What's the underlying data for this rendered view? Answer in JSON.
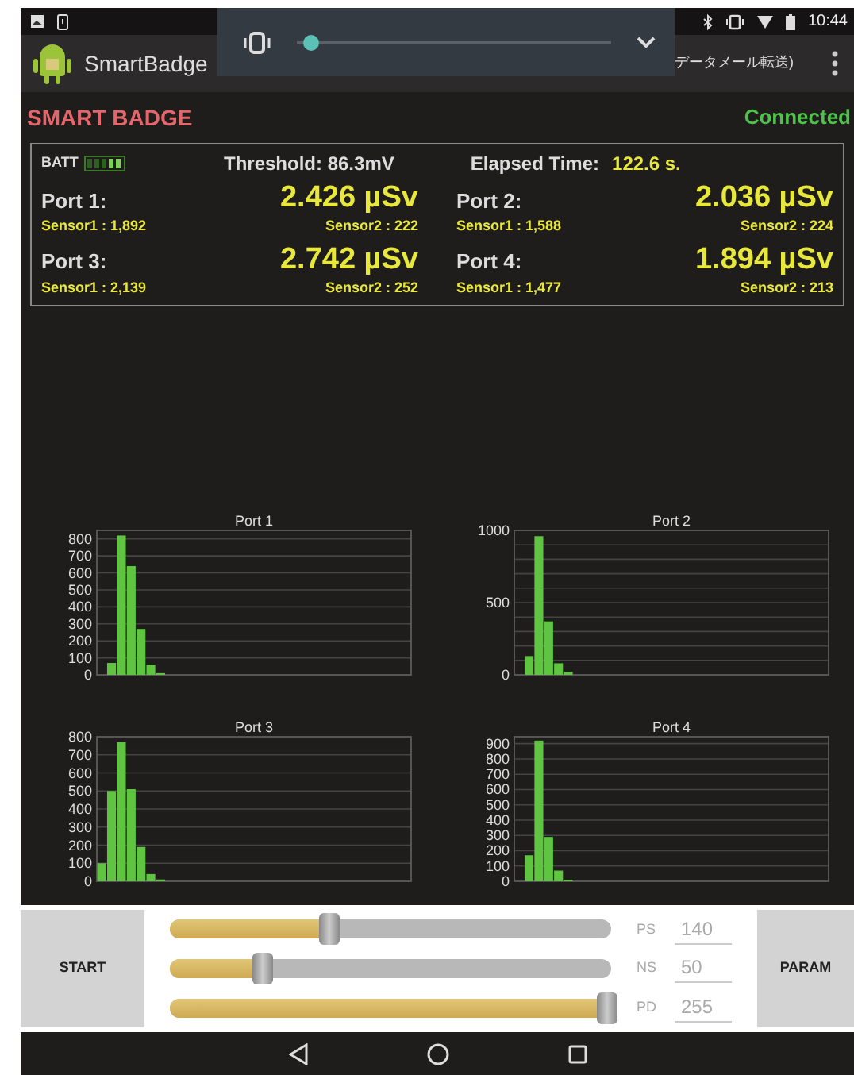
{
  "status_bar": {
    "time": "10:44"
  },
  "volume_panel": {
    "level": 0.02
  },
  "app_bar": {
    "title": "SmartBadge",
    "action": "データメール転送)"
  },
  "header": {
    "title": "SMART BADGE",
    "connection": "Connected"
  },
  "summary": {
    "battery_label": "BATT",
    "threshold": "Threshold: 86.3mV",
    "elapsed_label": "Elapsed Time:",
    "elapsed_value": "122.6 s.",
    "ports": [
      {
        "label": "Port 1:",
        "dose": "2.426 µSv",
        "sensor1": "Sensor1 : 1,892",
        "sensor2": "Sensor2 : 222"
      },
      {
        "label": "Port 2:",
        "dose": "2.036 µSv",
        "sensor1": "Sensor1 : 1,588",
        "sensor2": "Sensor2 : 224"
      },
      {
        "label": "Port 3:",
        "dose": "2.742 µSv",
        "sensor1": "Sensor1 : 2,139",
        "sensor2": "Sensor2 : 252"
      },
      {
        "label": "Port 4:",
        "dose": "1.894 µSv",
        "sensor1": "Sensor1 : 1,477",
        "sensor2": "Sensor2 : 213"
      }
    ]
  },
  "charts": [
    {
      "chart_data": {
        "type": "bar",
        "title": "Port 1",
        "ylim": [
          0,
          850
        ],
        "yticks": [
          0,
          100,
          200,
          300,
          400,
          500,
          600,
          700,
          800
        ],
        "grid": true,
        "categories": [
          null,
          null,
          null,
          null,
          null,
          null,
          null,
          null,
          null,
          null,
          null,
          null,
          null,
          null,
          null,
          null,
          null,
          null,
          null,
          null,
          null,
          null,
          null,
          null,
          null,
          null,
          null,
          null,
          null,
          null,
          null,
          null
        ],
        "values": [
          0,
          70,
          820,
          640,
          270,
          60,
          10,
          0,
          0,
          0,
          0,
          0,
          0,
          0,
          0,
          0,
          0,
          0,
          0,
          0,
          0,
          0,
          0,
          0,
          0,
          0,
          0,
          0,
          0,
          0,
          0,
          0
        ]
      }
    },
    {
      "chart_data": {
        "type": "bar",
        "title": "Port 2",
        "ylim": [
          0,
          1000
        ],
        "yticks": [
          0,
          500,
          1000
        ],
        "grid": true,
        "categories": [
          null,
          null,
          null,
          null,
          null,
          null,
          null,
          null,
          null,
          null,
          null,
          null,
          null,
          null,
          null,
          null,
          null,
          null,
          null,
          null,
          null,
          null,
          null,
          null,
          null,
          null,
          null,
          null,
          null,
          null,
          null,
          null
        ],
        "values": [
          0,
          130,
          960,
          370,
          80,
          20,
          0,
          0,
          0,
          0,
          0,
          0,
          0,
          0,
          0,
          0,
          0,
          0,
          0,
          0,
          0,
          0,
          0,
          0,
          0,
          0,
          0,
          0,
          0,
          0,
          0,
          0
        ]
      }
    },
    {
      "chart_data": {
        "type": "bar",
        "title": "Port 3",
        "ylim": [
          0,
          800
        ],
        "yticks": [
          0,
          100,
          200,
          300,
          400,
          500,
          600,
          700,
          800
        ],
        "grid": true,
        "categories": [
          null,
          null,
          null,
          null,
          null,
          null,
          null,
          null,
          null,
          null,
          null,
          null,
          null,
          null,
          null,
          null,
          null,
          null,
          null,
          null,
          null,
          null,
          null,
          null,
          null,
          null,
          null,
          null,
          null,
          null,
          null,
          null
        ],
        "values": [
          100,
          500,
          770,
          510,
          190,
          40,
          10,
          0,
          0,
          0,
          0,
          0,
          0,
          0,
          0,
          0,
          0,
          0,
          0,
          0,
          0,
          0,
          0,
          0,
          0,
          0,
          0,
          0,
          0,
          0,
          0,
          0
        ]
      }
    },
    {
      "chart_data": {
        "type": "bar",
        "title": "Port 4",
        "ylim": [
          0,
          945
        ],
        "yticks": [
          0,
          100,
          200,
          300,
          400,
          500,
          600,
          700,
          800,
          900
        ],
        "grid": true,
        "categories": [
          null,
          null,
          null,
          null,
          null,
          null,
          null,
          null,
          null,
          null,
          null,
          null,
          null,
          null,
          null,
          null,
          null,
          null,
          null,
          null,
          null,
          null,
          null,
          null,
          null,
          null,
          null,
          null,
          null,
          null,
          null,
          null
        ],
        "values": [
          0,
          170,
          920,
          290,
          70,
          10,
          0,
          0,
          0,
          0,
          0,
          0,
          0,
          0,
          0,
          0,
          0,
          0,
          0,
          0,
          0,
          0,
          0,
          0,
          0,
          0,
          0,
          0,
          0,
          0,
          0,
          0
        ]
      }
    }
  ],
  "controls": {
    "start": "START",
    "param": "PARAM",
    "sliders": [
      {
        "label": "PS",
        "value": "140",
        "level": 0.36
      },
      {
        "label": "NS",
        "value": "50",
        "level": 0.21
      },
      {
        "label": "PD",
        "value": "255",
        "level": 0.99
      }
    ]
  }
}
